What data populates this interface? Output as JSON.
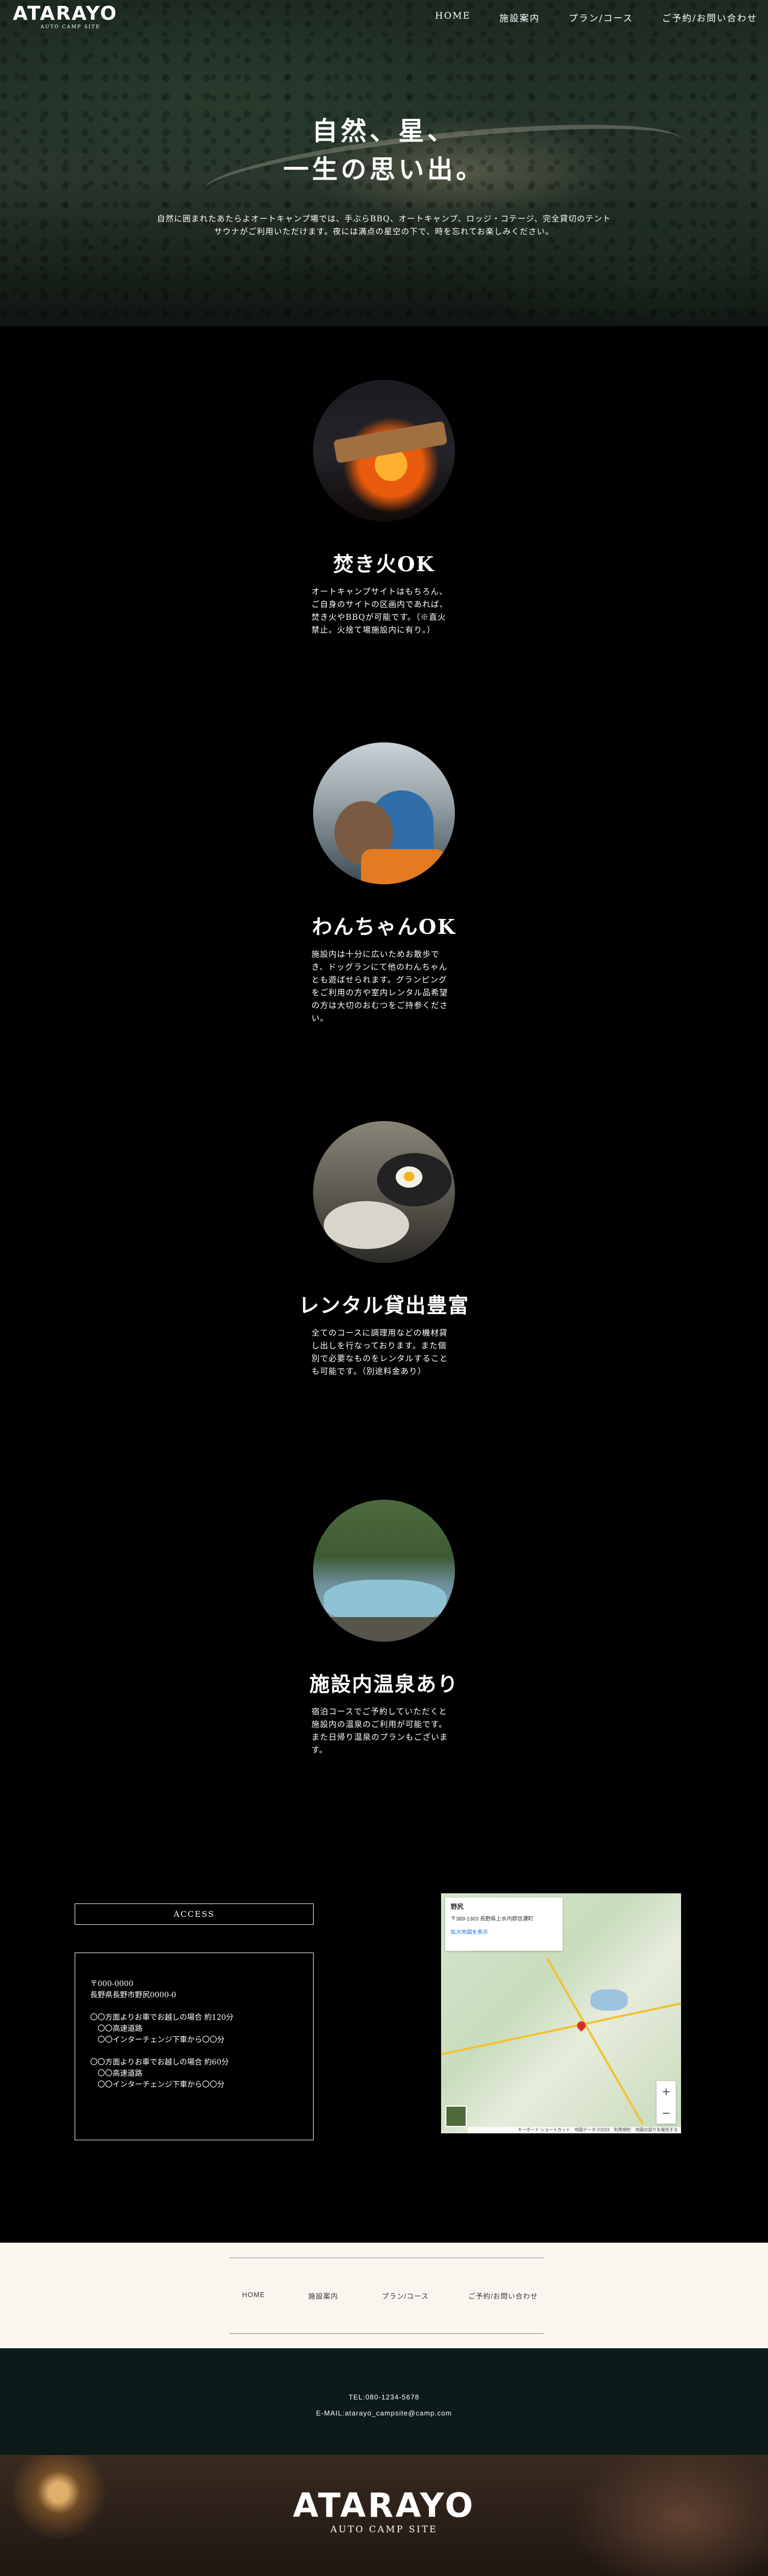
{
  "header": {
    "logo": "ATARAYO",
    "logo_sub": "AUTO CAMP SITE",
    "nav": [
      "HOME",
      "施設案内",
      "プラン/コース",
      "ご予約/お問い合わせ"
    ]
  },
  "hero": {
    "title_line1": "自然、星、",
    "title_line2": "一生の思い出。",
    "text_line1": "自然に囲まれたあたらよオートキャンプ場では、手ぶらBBQ、オートキャンプ、ロッジ・コテージ、完全貸切のテント",
    "text_line2": "サウナがご利用いただけます。夜には満点の星空の下で、時を忘れてお楽しみください。"
  },
  "features": [
    {
      "title": "焚き火OK",
      "text": "オートキャンプサイトはもちろん、ご自身のサイトの区画内であれば、焚き火やBBQが可能です。（※直火禁止。火捨て場施設内に有り。）",
      "photo": "campfire-photo"
    },
    {
      "title": "わんちゃんOK",
      "text": "施設内は十分に広いためお散歩でき、ドッグランにて他のわんちゃんとも遊ばせられます。グランピングをご利用の方や室内レンタル品希望の方は大切のおむつをご持参ください。",
      "photo": "dog-photo"
    },
    {
      "title": "レンタル貸出豊富",
      "text": "全てのコースに調理用などの機材貸し出しを行なっております。また個別で必要なものをレンタルすることも可能です。（別途料金あり）",
      "photo": "cookware-photo"
    },
    {
      "title": "施設内温泉あり",
      "text": "宿泊コースでご予約していただくと施設内の温泉のご利用が可能です。また日帰り温泉のプランもございます。",
      "photo": "hot-spring-photo"
    }
  ],
  "access": {
    "heading": "ACCESS",
    "lines": [
      "〒000-0000",
      "長野県長野市野尻0000-0",
      "",
      "〇〇方面よりお車でお越しの場合 約120分",
      "〇〇高速道路",
      "〇〇インターチェンジ下車から〇〇分",
      "",
      "〇〇方面よりお車でお越しの場合 約60分",
      "〇〇高速道路",
      "〇〇インターチェンジ下車から〇〇分"
    ],
    "map": {
      "place": "野尻",
      "address": "〒389-1303 長野県上水内郡信濃町",
      "link": "拡大地図を表示",
      "footer": "キーボード ショートカット　地図データ ©2023　利用規約　地図の誤りを報告する",
      "zoom_in": "+",
      "zoom_out": "−"
    }
  },
  "footer_nav": [
    "HOME",
    "施設案内",
    "プラン/コース",
    "ご予約/お問い合わせ"
  ],
  "contact": {
    "tel": "TEL:080-1234-5678",
    "email": "E-MAIL:atarayo_campsite@camp.com"
  },
  "bottom_logo": {
    "main": "ATARAYO",
    "sub": "AUTO CAMP SITE"
  }
}
